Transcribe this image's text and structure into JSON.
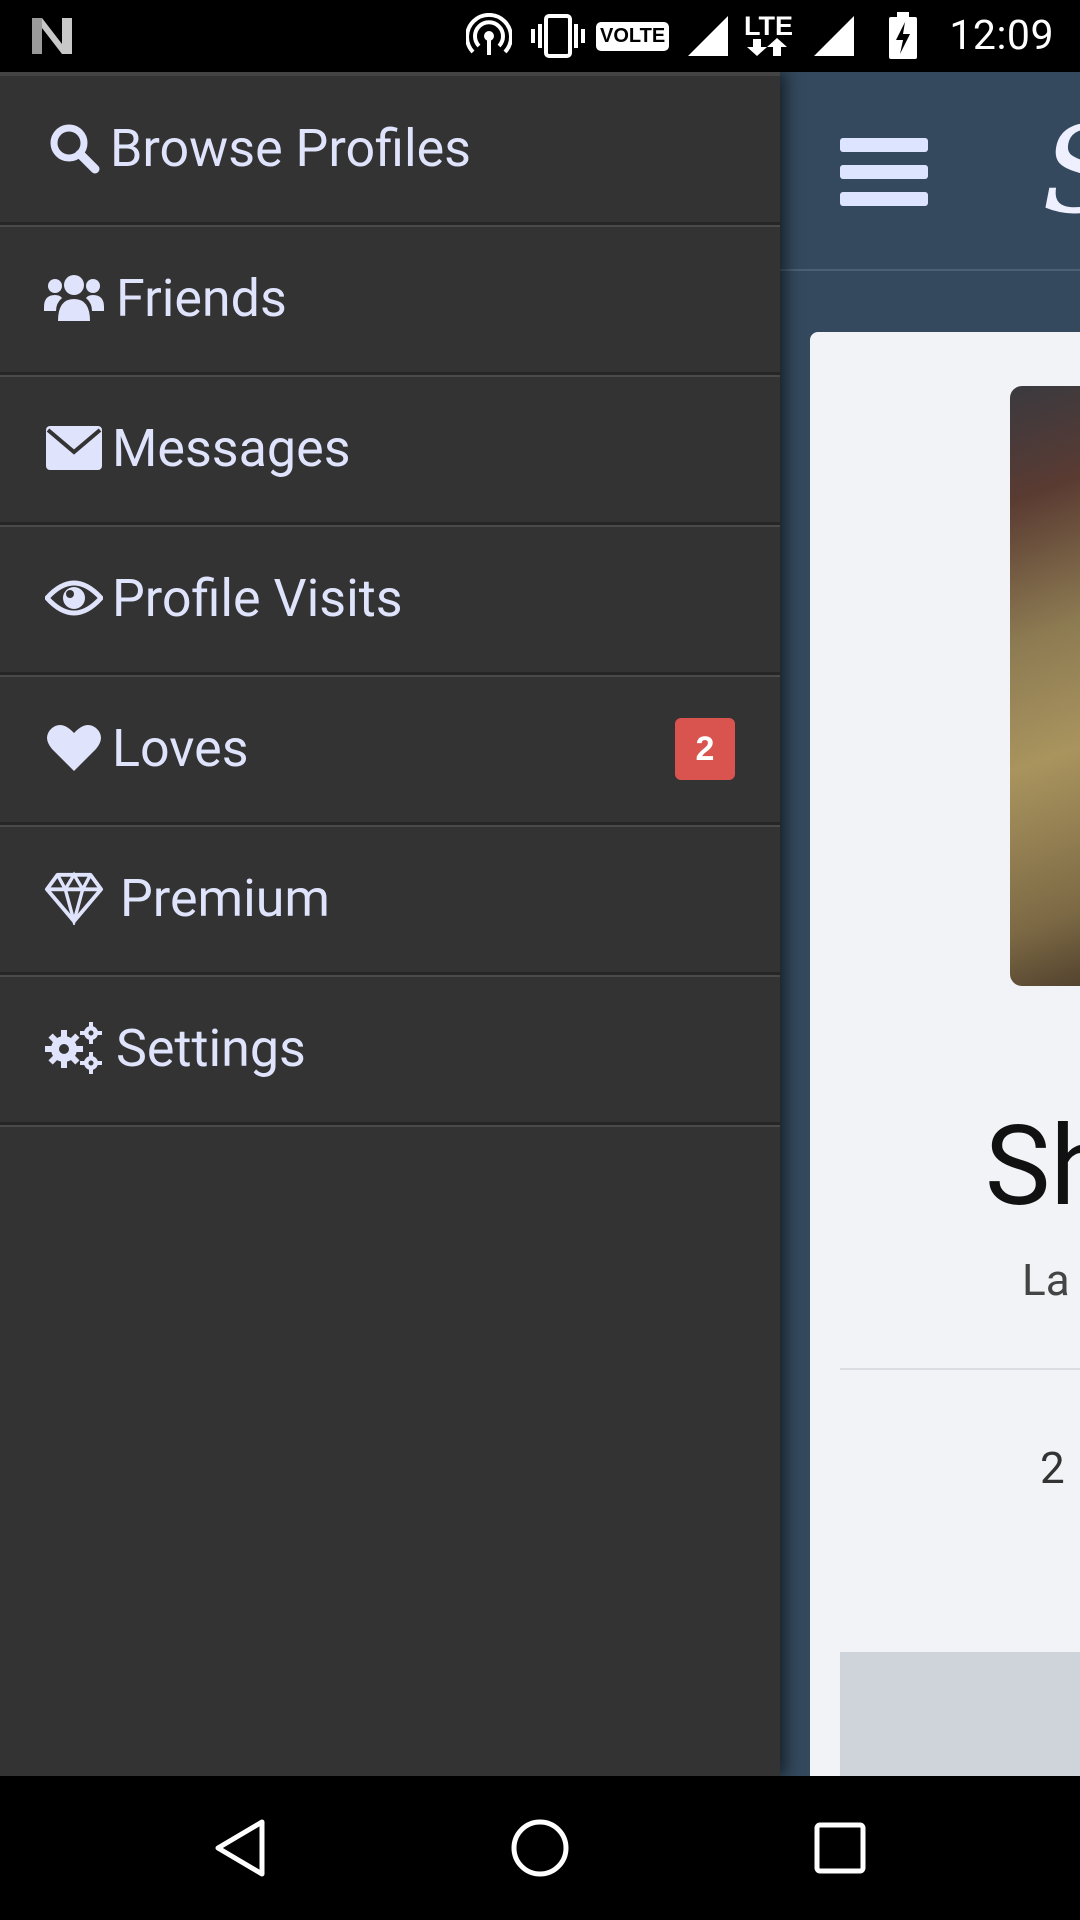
{
  "status_bar": {
    "time": "12:09",
    "volte_label": "VOLTE",
    "network_label": "LTE",
    "icons": [
      "notification-n-icon",
      "hotspot-icon",
      "vibrate-icon",
      "signal-icon",
      "battery-charging-icon"
    ]
  },
  "drawer": {
    "items": [
      {
        "label": "Browse Profiles",
        "icon": "search-icon"
      },
      {
        "label": "Friends",
        "icon": "users-icon"
      },
      {
        "label": "Messages",
        "icon": "envelope-icon"
      },
      {
        "label": "Profile Visits",
        "icon": "eye-icon"
      },
      {
        "label": "Loves",
        "icon": "heart-icon",
        "badge": "2"
      },
      {
        "label": "Premium",
        "icon": "diamond-icon"
      },
      {
        "label": "Settings",
        "icon": "gears-icon"
      }
    ]
  },
  "background_app": {
    "brand_partial": "S",
    "profile_name_partial": "Sh",
    "profile_sub_partial": "La",
    "profile_stat_partial": "2"
  },
  "nav_bar": {
    "icons": [
      "back-icon",
      "home-icon",
      "recents-icon"
    ]
  },
  "colors": {
    "drawer_bg": "#333333",
    "menu_text": "#dfe3fb",
    "badge_bg": "#d9534f",
    "app_header_bg": "#34495e",
    "card_bg": "#f2f3f7"
  }
}
